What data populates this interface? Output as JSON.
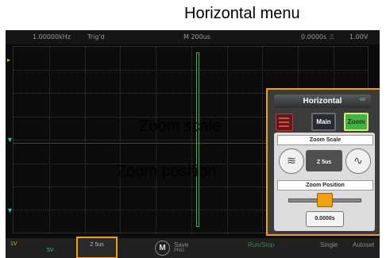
{
  "captions": {
    "horizontal_menu": "Horizontal menu",
    "zoom_scale": "Zoom scale",
    "zoom_position": "Zoom position"
  },
  "statusbar": {
    "frequency": "1.00000kHz",
    "trigger_status": "Trig'd",
    "timebase": "M 200us",
    "trigger_position": "0.0000s",
    "trigger_level": "1.00V"
  },
  "menu": {
    "title": "Horizontal",
    "tab_main": "Main",
    "tab_zoom": "Zoom",
    "zoom_scale_label": "Zoom Scale",
    "zoom_scale_value": "Z 5us",
    "zoom_position_label": "Zoom Position",
    "zoom_position_value": "0.0000s"
  },
  "bottombar": {
    "ch1_scale": "1V",
    "ch2_scale": "5V",
    "timebase_label": "Z 5us",
    "m_button": "M",
    "save_label": "Save",
    "save_sub": "PNG",
    "run_stop": "Run/Stop",
    "single": "Single",
    "autoset": "Autoset"
  },
  "colors": {
    "highlight": "#f0a012",
    "trace": "#3fb64a"
  },
  "icons": {
    "list": "list-icon",
    "zoom_decrease": "compress-wave-icon",
    "zoom_increase": "expand-wave-icon"
  }
}
